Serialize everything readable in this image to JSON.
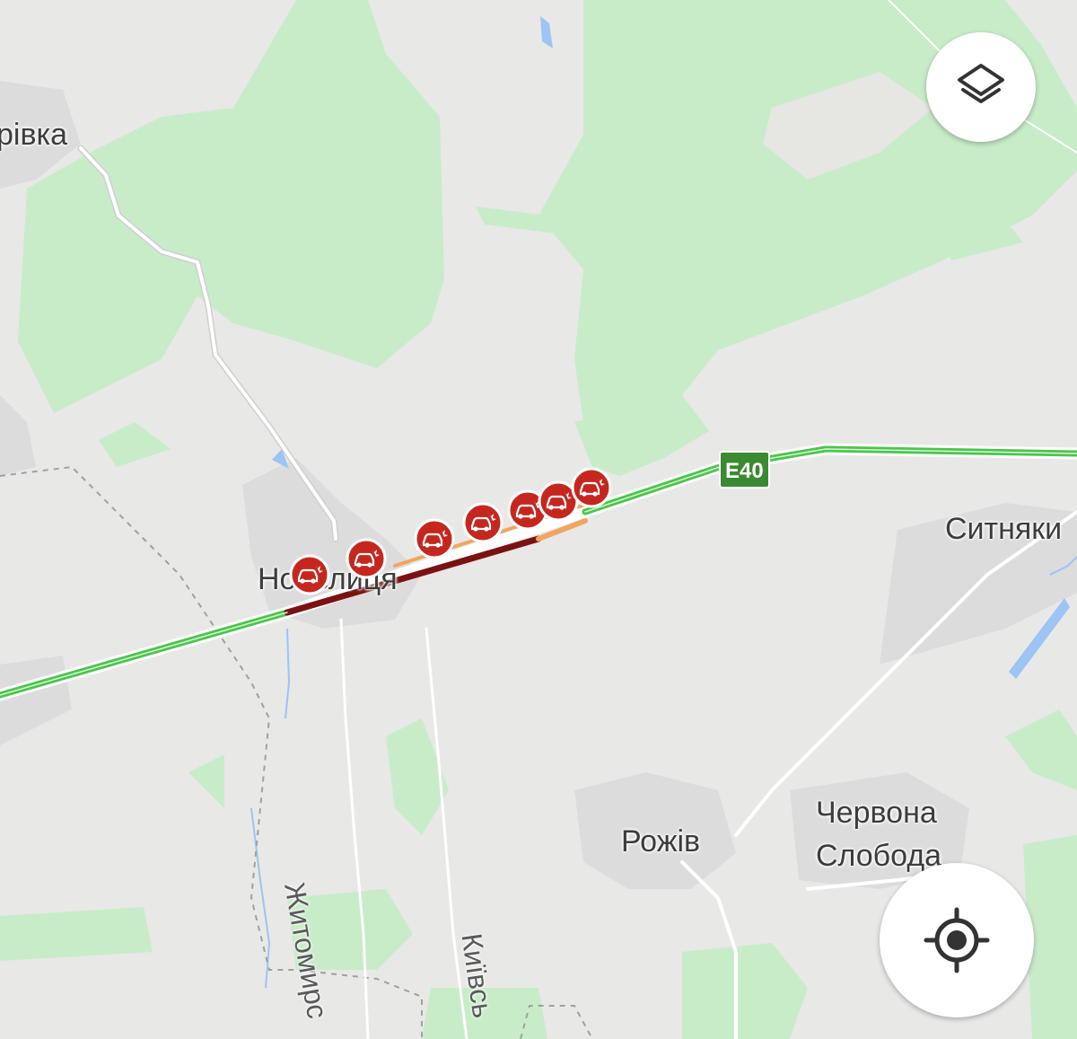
{
  "map": {
    "place_labels": {
      "ivka_partial": "рівка",
      "novelytsia": "Новелиця",
      "sytniaky": "Ситняки",
      "rozhiv": "Рожів",
      "chervona_line1": "Червона",
      "chervona_line2": "Слобода"
    },
    "road_labels": {
      "zhytomyrska_partial": "Житомирс",
      "kyivska_partial": "Київсь"
    },
    "highway_shield": "E40",
    "traffic": {
      "free_flow_color": "#4cc44c",
      "slow_color": "#f0a560",
      "jam_color": "#7b1212",
      "incident_color": "#c5271f"
    },
    "incidents": [
      {
        "type": "crash-icon"
      },
      {
        "type": "crash-icon"
      },
      {
        "type": "crash-icon"
      },
      {
        "type": "crash-icon"
      },
      {
        "type": "crash-icon"
      },
      {
        "type": "crash-icon"
      },
      {
        "type": "crash-icon"
      }
    ]
  },
  "controls": {
    "layers_icon": "layers-icon",
    "locate_icon": "my-location-icon"
  }
}
